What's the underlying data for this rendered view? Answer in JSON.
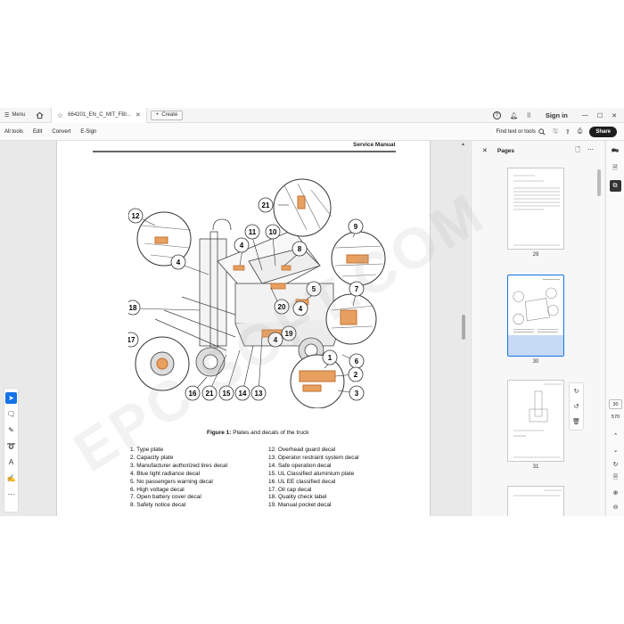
{
  "titlebar": {
    "menu_label": "Menu",
    "tab_title": "664201_EN_C_MIT_FBI...",
    "create_label": "Create",
    "sign_in": "Sign in"
  },
  "toolbar": {
    "items": [
      "All tools",
      "Edit",
      "Convert",
      "E-Sign"
    ],
    "find_label": "Find text or tools",
    "share_label": "Share"
  },
  "page": {
    "header": "Service Manual",
    "caption_bold": "Figure 1:",
    "caption_text": " Plates and decals of the truck",
    "legend_left": [
      "1. Type plate",
      "2. Capacity plate",
      "3. Manufacturer authorized tires decal",
      "4. Blue light radiance decal",
      "5. No passengers warning decal",
      "6. High voltage decal",
      "7. Open battery cover decal",
      "8. Safety notice decal"
    ],
    "legend_right": [
      "12. Overhead guard decal",
      "13. Operator restraint system decal",
      "14. Safe operation decal",
      "15. UL Classified aluminium plate",
      "16. UL EE classified decal",
      "17. Oil cap decal",
      "18. Quality check label",
      "19. Manual pocket decal"
    ],
    "callouts": [
      "21",
      "12",
      "11",
      "10",
      "9",
      "4",
      "8",
      "4",
      "5",
      "7",
      "18",
      "20",
      "4",
      "19",
      "17",
      "4",
      "6",
      "2",
      "16",
      "21",
      "15",
      "14",
      "13",
      "3",
      "1"
    ]
  },
  "pages_panel": {
    "title": "Pages",
    "thumbnails": [
      {
        "label": "29",
        "selected": false
      },
      {
        "label": "30",
        "selected": true
      },
      {
        "label": "31",
        "selected": false
      }
    ]
  },
  "right_rail": {
    "current_page": "30",
    "total_pages": "570"
  },
  "colors": {
    "accent": "#1473e6",
    "decal_orange": "#e8a060",
    "selection_fill": "#c6d9f5"
  },
  "watermark": "EPC SOFT.COM"
}
